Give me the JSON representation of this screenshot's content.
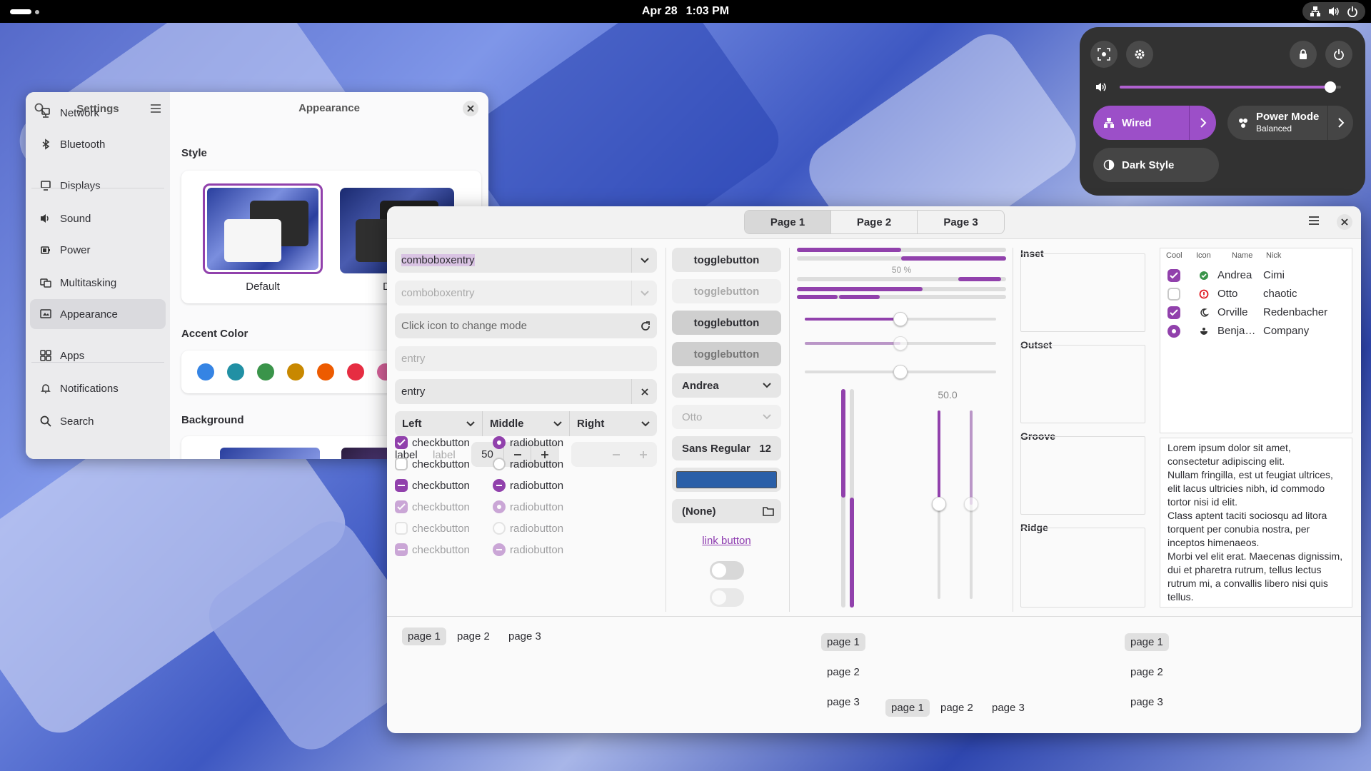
{
  "topbar": {
    "date": "Apr 28",
    "time": "1:03 PM"
  },
  "quick_settings": {
    "volume": 0.95,
    "wired_label": "Wired",
    "power_mode_label": "Power Mode",
    "power_mode_value": "Balanced",
    "dark_style_label": "Dark Style"
  },
  "settings": {
    "sidebar_title": "Settings",
    "page_title": "Appearance",
    "items": [
      {
        "label": "Network",
        "icon": "network-icon"
      },
      {
        "label": "Bluetooth",
        "icon": "bluetooth-icon"
      },
      {
        "label": "Displays",
        "icon": "display-icon"
      },
      {
        "label": "Sound",
        "icon": "sound-icon"
      },
      {
        "label": "Power",
        "icon": "power-icon"
      },
      {
        "label": "Multitasking",
        "icon": "multitasking-icon"
      },
      {
        "label": "Appearance",
        "icon": "appearance-icon"
      },
      {
        "label": "Apps",
        "icon": "apps-icon"
      },
      {
        "label": "Notifications",
        "icon": "bell-icon"
      },
      {
        "label": "Search",
        "icon": "search-icon"
      }
    ],
    "style_label": "Style",
    "style_default": "Default",
    "style_dark_partial": "D",
    "accent_label": "Accent Color",
    "accent_colors": [
      "#3584e4",
      "#2190a4",
      "#3a944a",
      "#c88800",
      "#ed5b00",
      "#e62d42",
      "#d56199"
    ],
    "background_label": "Background"
  },
  "demo": {
    "tabs": [
      "Page 1",
      "Page 2",
      "Page 3"
    ],
    "combo1": "comboboxentry",
    "combo2": "comboboxentry",
    "mode_placeholder": "Click icon to change mode",
    "entry_placeholder": "entry",
    "entry_value": "entry",
    "seg_left": "Left",
    "seg_middle": "Middle",
    "seg_right": "Right",
    "spin_label1": "label",
    "spin_label2": "label",
    "spin_value": "50",
    "check_label": "checkbutton",
    "radio_label": "radiobutton",
    "toggle_label": "togglebutton",
    "combo_andrea": "Andrea",
    "combo_otto": "Otto",
    "font_name": "Sans Regular",
    "font_size": "12",
    "color_value": "#2a5fa8",
    "file_none": "(None)",
    "link_label": "link button",
    "progress_label": "50 %",
    "scale_value": "50.0",
    "frames": [
      "Inset",
      "Outset",
      "Groove",
      "Ridge"
    ],
    "tree_headers": [
      "Cool",
      "Icon",
      "Name",
      "Nick"
    ],
    "tree_rows": [
      {
        "cool": "checked",
        "icon": "ok-icon",
        "name": "Andrea",
        "nick": "Cimi"
      },
      {
        "cool": "unchecked",
        "icon": "error-icon",
        "name": "Otto",
        "nick": "chaotic"
      },
      {
        "cool": "checked",
        "icon": "moon-icon",
        "name": "Orville",
        "nick": "Redenbacher"
      },
      {
        "cool": "radio",
        "icon": "bowl-icon",
        "name": "Benja…",
        "nick": "Company"
      }
    ],
    "text": "Lorem ipsum dolor sit amet, consectetur adipiscing elit.\nNullam fringilla, est ut feugiat ultrices, elit lacus ultricies nibh, id commodo tortor nisi id elit.\nClass aptent taciti sociosqu ad litora torquent per conubia nostra, per inceptos himenaeos.\nMorbi vel elit erat. Maecenas dignissim, dui et pharetra rutrum, tellus lectus rutrum mi, a convallis libero nisi quis tellus.\nNulla facilisi. Nullam eleifend",
    "pages": [
      "page 1",
      "page 2",
      "page 3"
    ]
  }
}
